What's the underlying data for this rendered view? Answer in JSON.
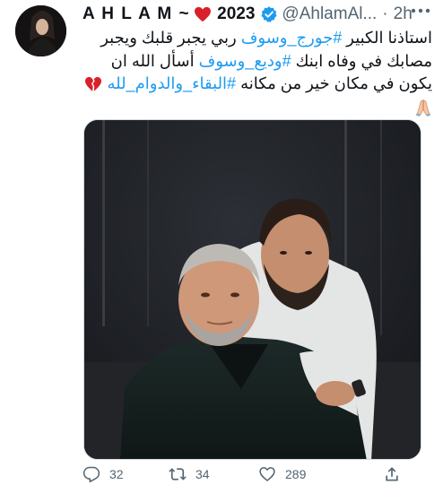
{
  "tweet": {
    "display_name": "A H L A M ~",
    "year": "2023",
    "handle": "@AhlamAl...",
    "separator": "·",
    "time": "2h",
    "text_lines": [
      [
        {
          "text": "استاذنا الكبير ",
          "hashtag": false
        },
        {
          "text": "#جورج_وسوف",
          "hashtag": true
        },
        {
          "text": "  ربي يجبر قلبك ويجبر",
          "hashtag": false
        }
      ],
      [
        {
          "text": "مصابك في وفاه ابنك ",
          "hashtag": false
        },
        {
          "text": "#وديع_وسوف",
          "hashtag": true
        },
        {
          "text": "  أسأل الله ان",
          "hashtag": false
        }
      ],
      [
        {
          "text": "يكون في مكان خير من مكانه  ",
          "hashtag": false
        },
        {
          "text": "#البقاء_والدوام_لله",
          "hashtag": true
        }
      ]
    ],
    "emoji": {
      "line1_end": "red-heart",
      "line3_end": "broken-heart",
      "line4": "folded-hands"
    },
    "stats": {
      "replies": "32",
      "retweets": "34",
      "likes": "289"
    }
  },
  "colors": {
    "text": "#0f1419",
    "secondary": "#536471",
    "link": "#1d9bf0",
    "verified": "#1d9bf0"
  }
}
